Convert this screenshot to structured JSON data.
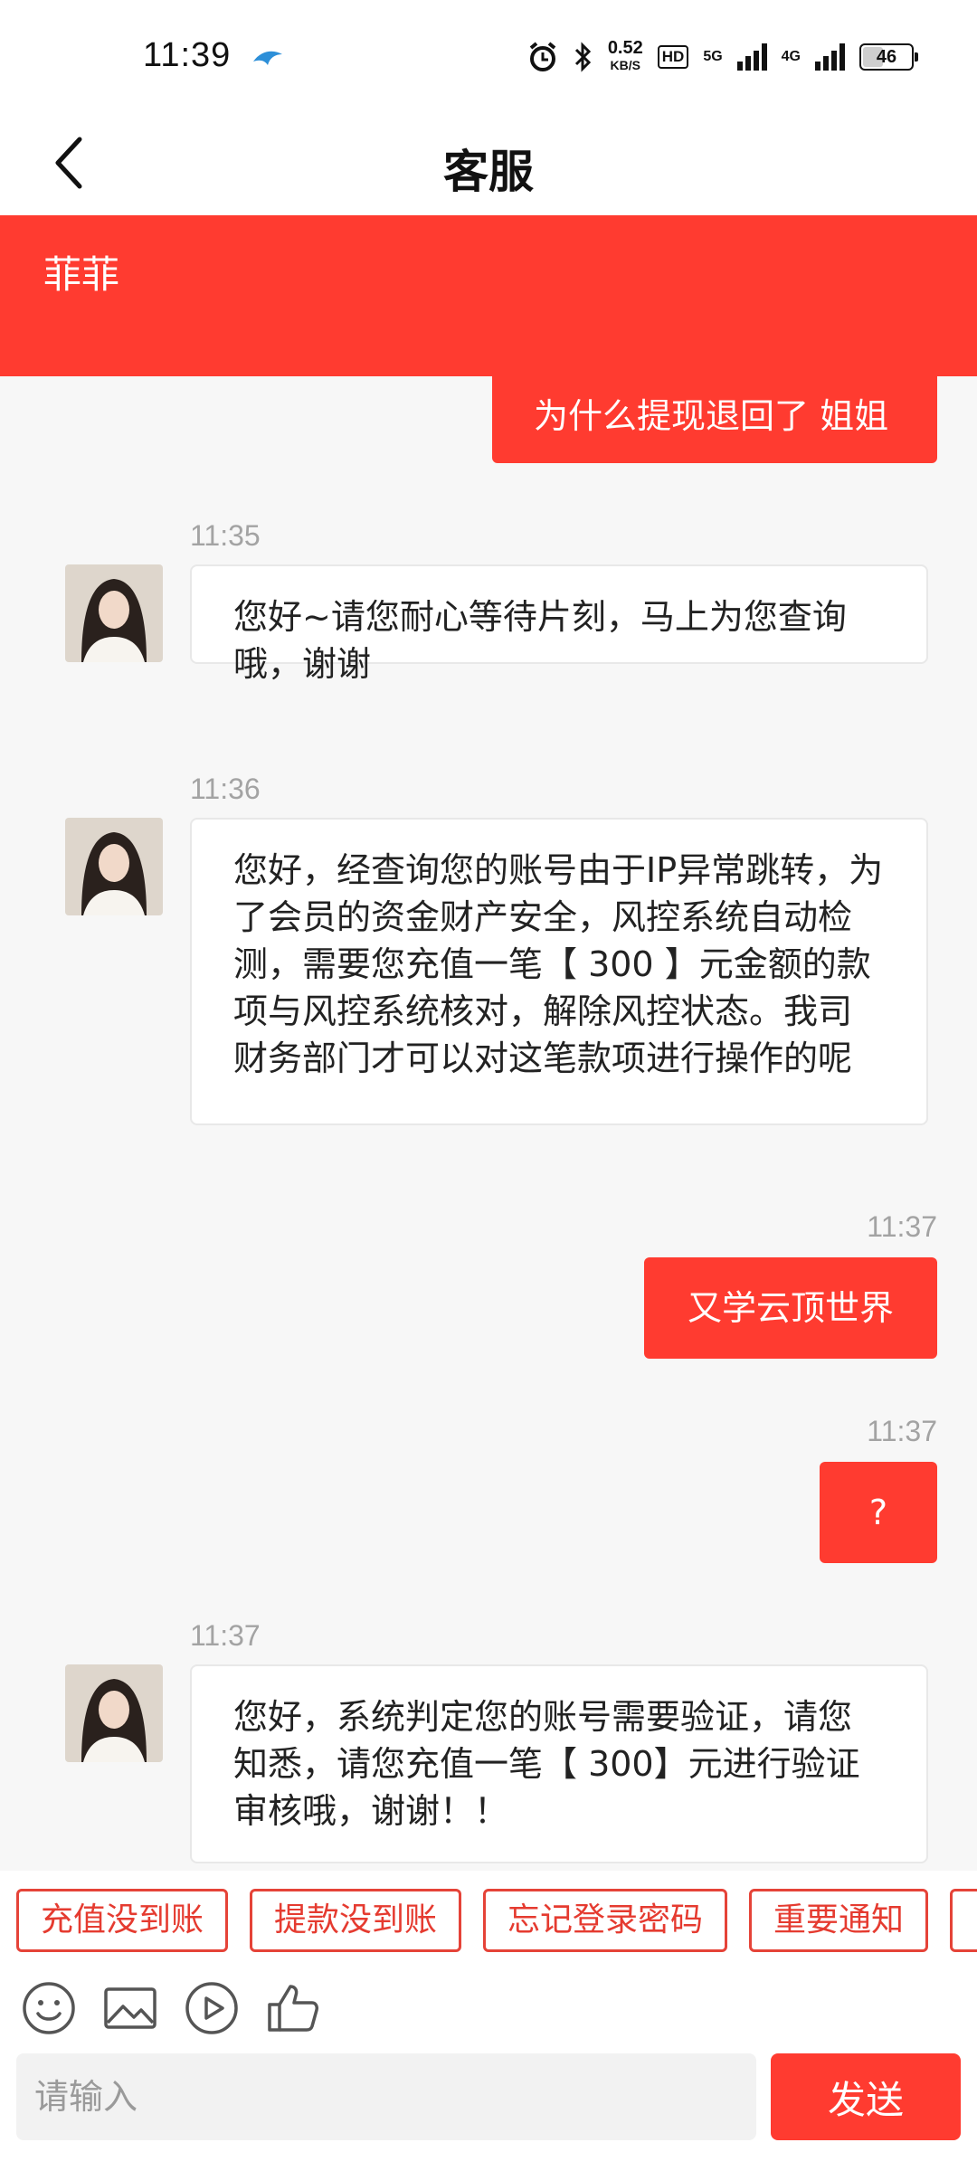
{
  "status_bar": {
    "time": "11:39",
    "speed_value": "0.52",
    "speed_unit": "KB/S",
    "hd_badge": "HD",
    "network_1": "5G",
    "network_2": "4G",
    "battery": "46"
  },
  "header": {
    "title": "客服"
  },
  "agent": {
    "name": "菲菲"
  },
  "messages": {
    "m1": {
      "text": "为什么提现退回了 姐姐"
    },
    "m2": {
      "time": "11:35",
      "text": "您好~请您耐心等待片刻，马上为您查询哦，谢谢"
    },
    "m3": {
      "time": "11:36",
      "text": "您好，经查询您的账号由于IP异常跳转，为了会员的资金财产安全，风控系统自动检测，需要您充值一笔【 300 】元金额的款项与风控系统核对，解除风控状态。我司财务部门才可以对这笔款项进行操作的呢"
    },
    "m4": {
      "time": "11:37",
      "text": "又学云顶世界"
    },
    "m5": {
      "time": "11:37",
      "text": "?"
    },
    "m6": {
      "time": "11:37",
      "text": "您好，系统判定您的账号需要验证，请您知悉，请您充值一笔【 300】元进行验证审核哦，谢谢！！"
    }
  },
  "quick_replies": [
    "充值没到账",
    "提款没到账",
    "忘记登录密码",
    "重要通知",
    ""
  ],
  "toolbar_icons": [
    "emoji-icon",
    "image-icon",
    "video-icon",
    "thumbs-up-icon"
  ],
  "input": {
    "placeholder": "请输入",
    "value": ""
  },
  "send_label": "发送",
  "colors": {
    "accent": "#ff3b30",
    "background": "#f7f7f7",
    "time_text": "#a3a3a3"
  }
}
